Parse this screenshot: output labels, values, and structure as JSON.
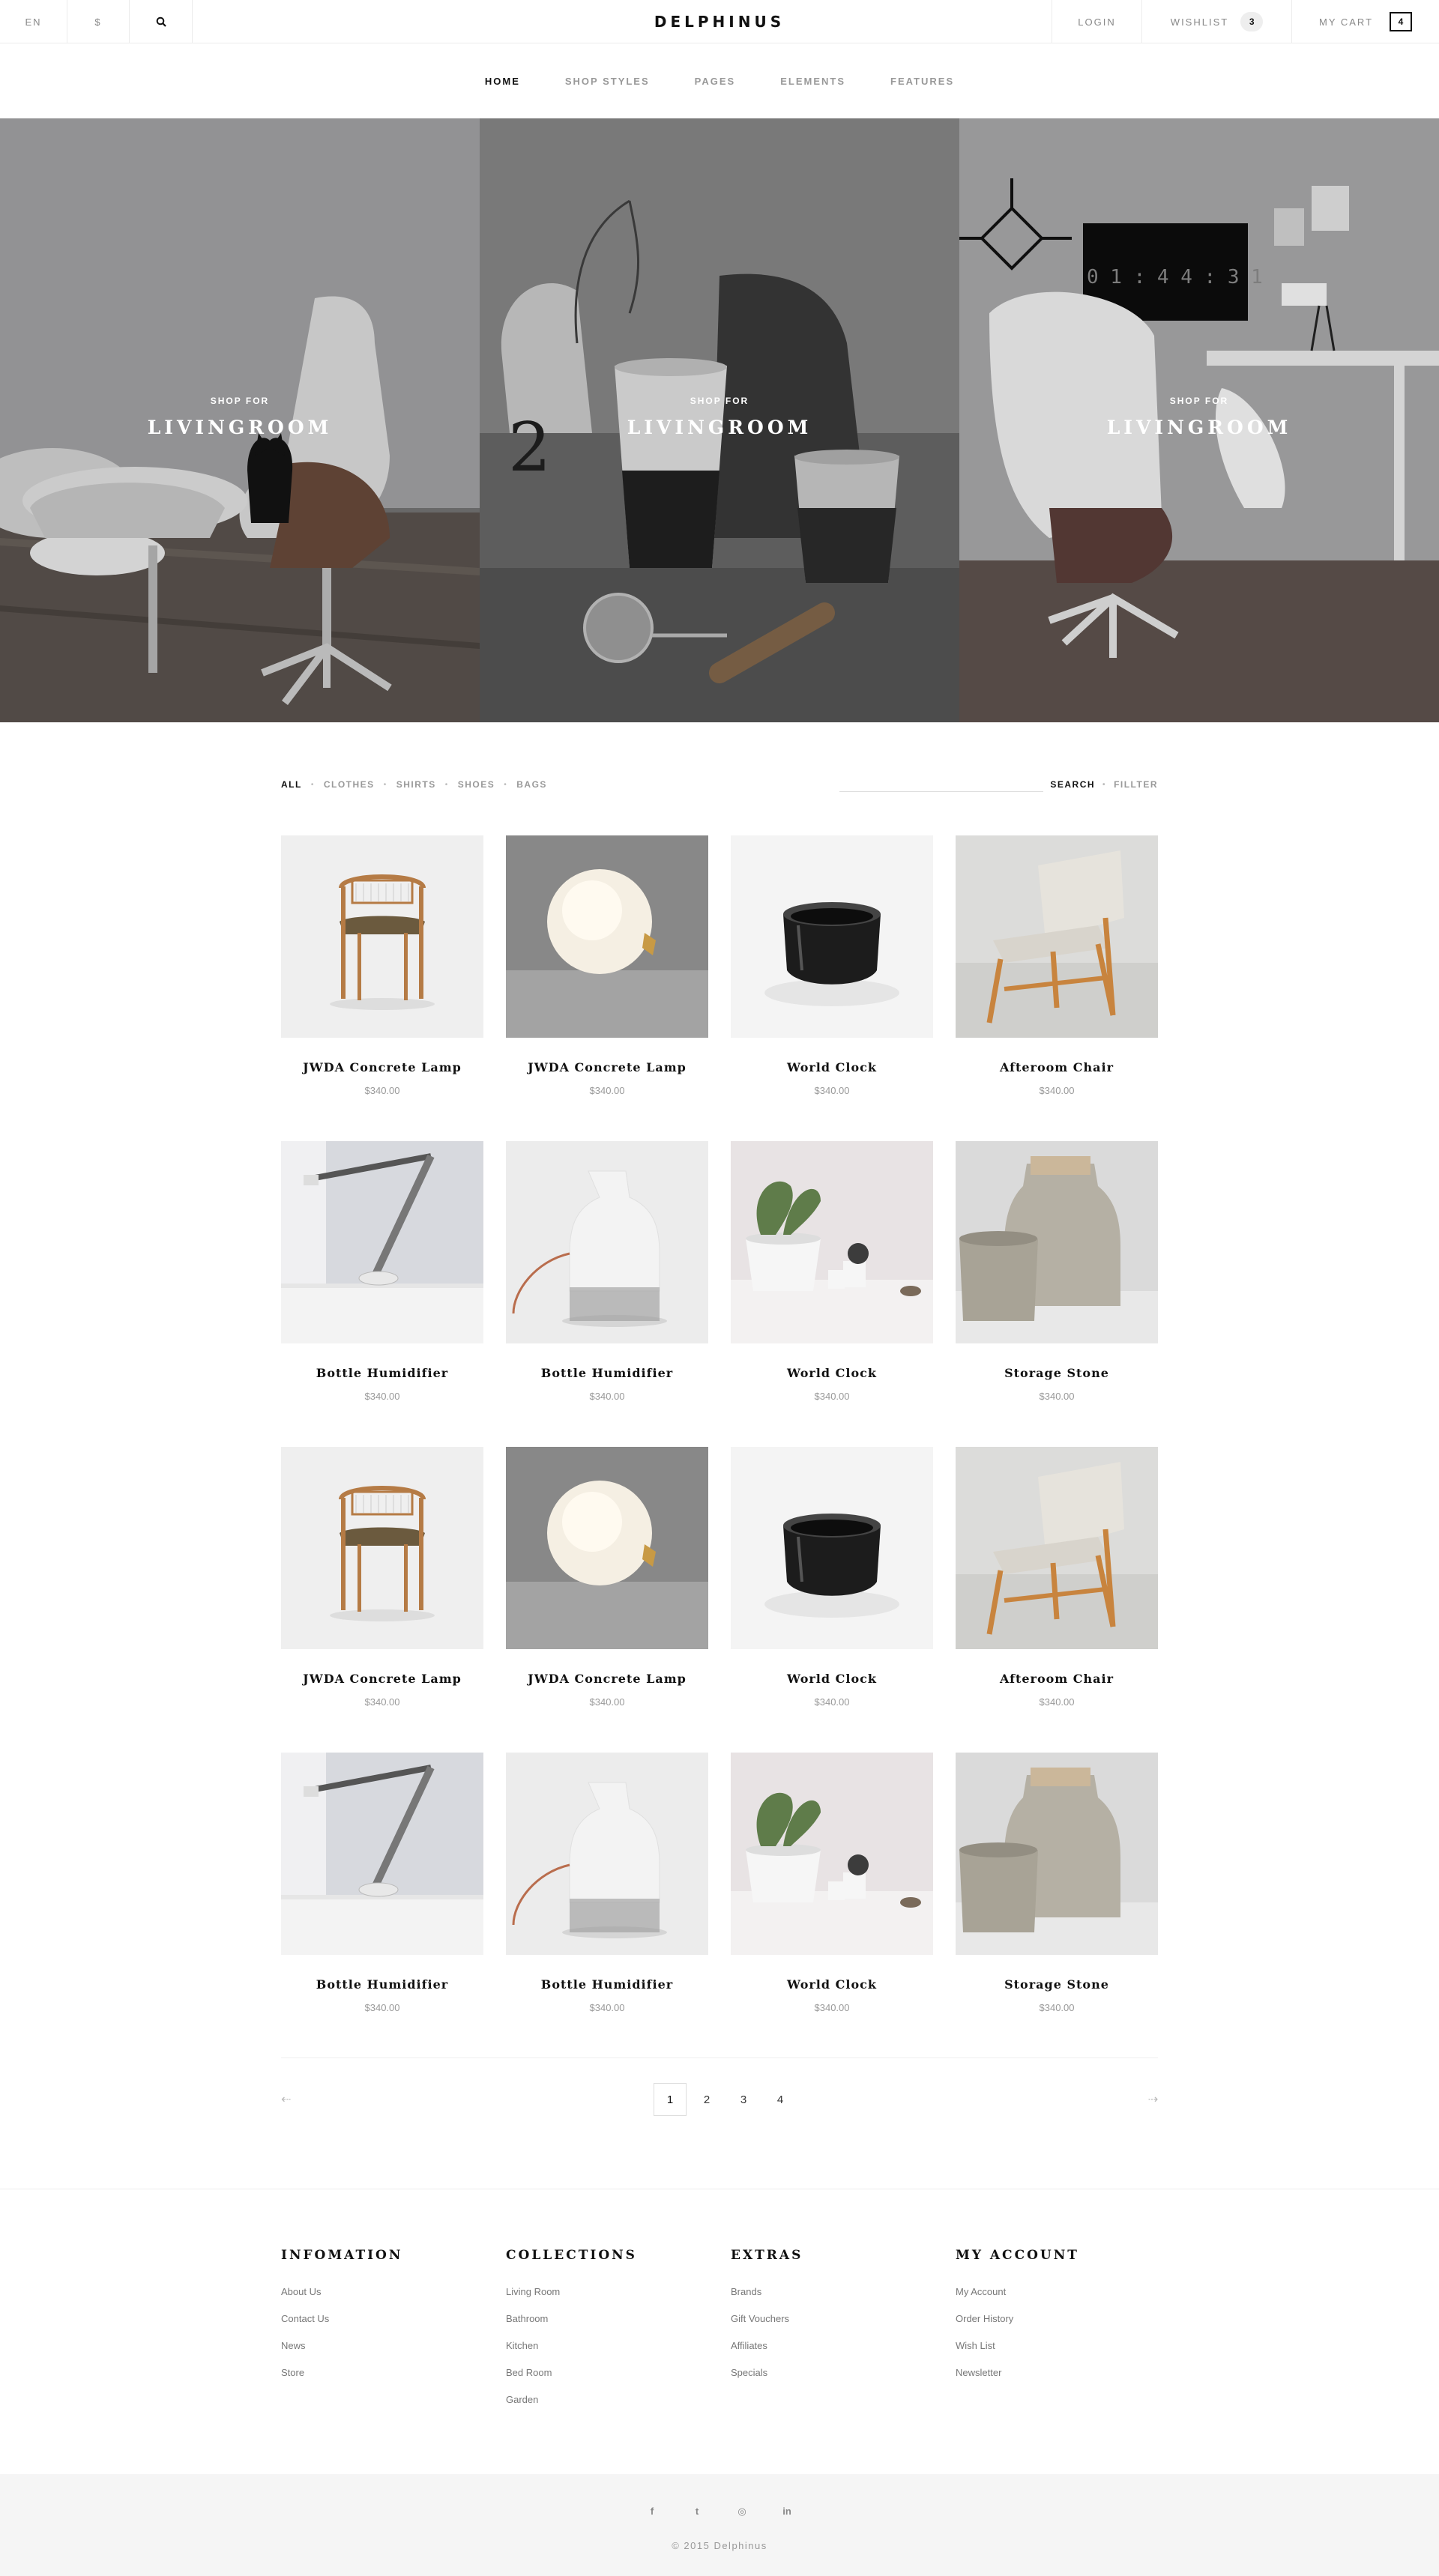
{
  "topbar": {
    "language": "EN",
    "currency": "$",
    "search_icon": "search-icon",
    "logo": "DELPHINUS",
    "login": "LOGIN",
    "wishlist_label": "WISHLIST",
    "wishlist_count": "3",
    "cart_label": "MY CART",
    "cart_count": "4"
  },
  "nav": {
    "items": [
      {
        "label": "HOME",
        "active": true
      },
      {
        "label": "SHOP STYLES"
      },
      {
        "label": "PAGES"
      },
      {
        "label": "ELEMENTS"
      },
      {
        "label": "FEATURES"
      }
    ]
  },
  "hero": {
    "panels": [
      {
        "kicker": "SHOP FOR",
        "title": "LIVINGROOM"
      },
      {
        "kicker": "SHOP FOR",
        "title": "LIVINGROOM"
      },
      {
        "kicker": "SHOP FOR",
        "title": "LIVINGROOM"
      }
    ]
  },
  "filters": {
    "categories": [
      {
        "label": "ALL",
        "active": true
      },
      {
        "label": "CLOTHES"
      },
      {
        "label": "SHIRTS"
      },
      {
        "label": "SHOES"
      },
      {
        "label": "BAGS"
      }
    ],
    "separator": "•",
    "search": "SEARCH",
    "filter": "FILLTER"
  },
  "products": [
    {
      "name": "JWDA Concrete Lamp",
      "price": "$340.00",
      "image": "wooden-armchair"
    },
    {
      "name": "JWDA Concrete Lamp",
      "price": "$340.00",
      "image": "globe-lamp"
    },
    {
      "name": "World Clock",
      "price": "$340.00",
      "image": "black-bowl"
    },
    {
      "name": "Afteroom Chair",
      "price": "$340.00",
      "image": "wood-chair"
    },
    {
      "name": "Bottle Humidifier",
      "price": "$340.00",
      "image": "desk-lamp"
    },
    {
      "name": "Bottle Humidifier",
      "price": "$340.00",
      "image": "bottle-humidifier"
    },
    {
      "name": "World Clock",
      "price": "$340.00",
      "image": "plant-pots"
    },
    {
      "name": "Storage Stone",
      "price": "$340.00",
      "image": "stone-jars"
    },
    {
      "name": "JWDA Concrete Lamp",
      "price": "$340.00",
      "image": "wooden-armchair"
    },
    {
      "name": "JWDA Concrete Lamp",
      "price": "$340.00",
      "image": "globe-lamp"
    },
    {
      "name": "World Clock",
      "price": "$340.00",
      "image": "black-bowl"
    },
    {
      "name": "Afteroom Chair",
      "price": "$340.00",
      "image": "wood-chair"
    },
    {
      "name": "Bottle Humidifier",
      "price": "$340.00",
      "image": "desk-lamp"
    },
    {
      "name": "Bottle Humidifier",
      "price": "$340.00",
      "image": "bottle-humidifier"
    },
    {
      "name": "World Clock",
      "price": "$340.00",
      "image": "plant-pots"
    },
    {
      "name": "Storage Stone",
      "price": "$340.00",
      "image": "stone-jars"
    }
  ],
  "pagination": {
    "prev_icon": "arrow-left-icon",
    "next_icon": "arrow-right-icon",
    "pages": [
      "1",
      "2",
      "3",
      "4"
    ],
    "current": "1"
  },
  "footer": {
    "columns": [
      {
        "title": "INFOMATION",
        "links": [
          "About Us",
          "Contact Us",
          "News",
          "Store"
        ]
      },
      {
        "title": "COLLECTIONS",
        "links": [
          "Living Room",
          "Bathroom",
          "Kitchen",
          "Bed Room",
          "Garden"
        ]
      },
      {
        "title": "EXTRAS",
        "links": [
          "Brands",
          "Gift Vouchers",
          "Affiliates",
          "Specials"
        ]
      },
      {
        "title": "MY ACCOUNT",
        "links": [
          "My Account",
          "Order History",
          "Wish List",
          "Newsletter"
        ]
      }
    ],
    "social": [
      {
        "glyph": "f",
        "icon": "facebook-icon"
      },
      {
        "glyph": "t",
        "icon": "twitter-icon"
      },
      {
        "glyph": "◎",
        "icon": "instagram-icon"
      },
      {
        "glyph": "in",
        "icon": "linkedin-icon"
      }
    ],
    "copyright": "© 2015 Delphinus"
  },
  "colors": {
    "text": "#111111",
    "muted": "#999999",
    "border": "#ececec",
    "footer_bg": "#f5f5f5"
  }
}
